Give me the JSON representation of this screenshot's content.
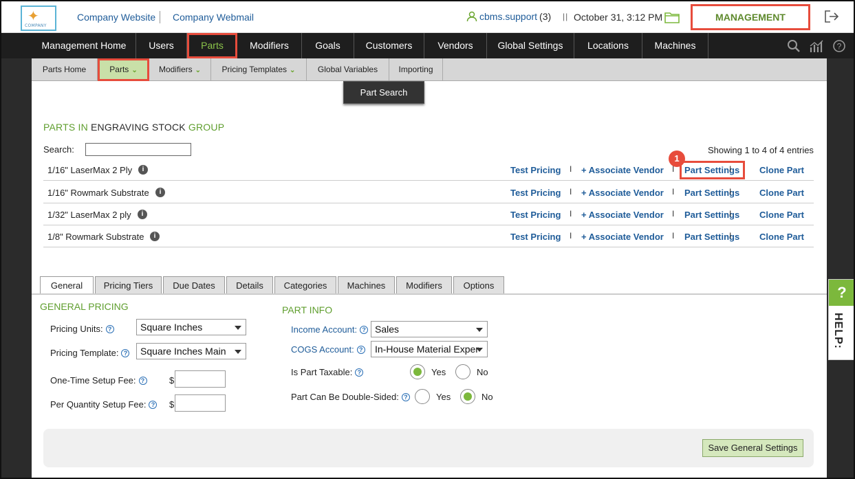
{
  "header": {
    "logo_text": "COMPANY",
    "links": [
      "Company Website",
      "Company Webmail"
    ],
    "user": "cbms.support",
    "user_count": "(3)",
    "separator": "||",
    "datetime": "October 31, 3:12 PM",
    "management_label": "MANAGEMENT"
  },
  "main_nav": [
    "Management Home",
    "Users",
    "Parts",
    "Modifiers",
    "Goals",
    "Customers",
    "Vendors",
    "Global Settings",
    "Locations",
    "Machines"
  ],
  "main_nav_active": "Parts",
  "sub_nav": [
    "Parts Home",
    "Parts",
    "Modifiers",
    "Pricing Templates",
    "Global Variables",
    "Importing"
  ],
  "sub_nav_active": "Parts",
  "dropdown_item": "Part Search",
  "group_title": {
    "prefix": "PARTS IN",
    "group": "ENGRAVING STOCK",
    "suffix": "GROUP"
  },
  "search": {
    "label": "Search:",
    "value": ""
  },
  "showing": "Showing 1 to 4 of 4 entries",
  "parts": [
    {
      "name": "1/16\" LaserMax 2 Ply"
    },
    {
      "name": "1/16\" Rowmark Substrate"
    },
    {
      "name": "1/32\" LaserMax 2 ply"
    },
    {
      "name": "1/8\" Rowmark Substrate"
    }
  ],
  "part_actions": [
    "Test Pricing",
    "+ Associate Vendor",
    "Part Settings",
    "Clone Part"
  ],
  "action_separator": "I",
  "callout_number": "1",
  "tabs": [
    "General",
    "Pricing Tiers",
    "Due Dates",
    "Details",
    "Categories",
    "Machines",
    "Modifiers",
    "Options"
  ],
  "active_tab": "General",
  "general_pricing": {
    "title": "GENERAL PRICING",
    "pricing_units_label": "Pricing Units:",
    "pricing_units_value": "Square Inches",
    "pricing_template_label": "Pricing Template:",
    "pricing_template_value": "Square Inches Main",
    "one_time_setup_label": "One-Time Setup Fee:",
    "per_quantity_setup_label": "Per Quantity Setup Fee:",
    "currency": "$",
    "one_time_setup_value": "",
    "per_quantity_setup_value": ""
  },
  "part_info": {
    "title": "PART INFO",
    "income_account_label": "Income Account:",
    "income_account_value": "Sales",
    "cogs_account_label": "COGS Account:",
    "cogs_account_value": "In-House Material Exper",
    "taxable_label": "Is Part Taxable:",
    "taxable_value": "Yes",
    "double_sided_label": "Part Can Be Double-Sided:",
    "double_sided_value": "No",
    "yes": "Yes",
    "no": "No"
  },
  "save_button": "Save General Settings",
  "help": {
    "q": "?",
    "label": "HELP:"
  },
  "colors": {
    "accent_green": "#5f9e2e",
    "link_blue": "#1f5c99",
    "highlight_red": "#e74c3c",
    "nav_dark": "#1e1e1e"
  }
}
